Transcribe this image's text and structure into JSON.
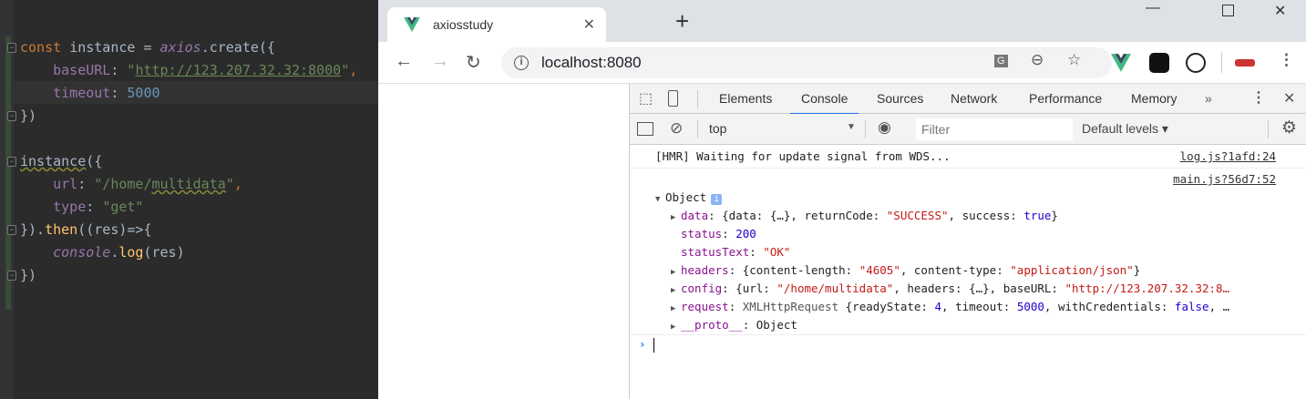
{
  "editor": {
    "lines": [
      {
        "parts": [
          [
            "kw",
            "const "
          ],
          [
            "",
            "instance = "
          ],
          [
            "it",
            "axios"
          ],
          [
            "",
            ".create({"
          ]
        ]
      },
      {
        "parts": [
          [
            "prop",
            "    baseURL"
          ],
          [
            "",
            ": "
          ],
          [
            "str",
            "\""
          ],
          [
            "url",
            "http://123.207.32.32:8000"
          ],
          [
            "str",
            "\""
          ],
          [
            "kw",
            ","
          ]
        ]
      },
      {
        "parts": [
          [
            "prop",
            "    timeout"
          ],
          [
            "",
            ": "
          ],
          [
            "num",
            "5000"
          ]
        ]
      },
      {
        "parts": [
          [
            "",
            "})"
          ]
        ]
      },
      {
        "parts": []
      },
      {
        "parts": [
          [
            "wv",
            "instance"
          ],
          [
            "",
            "({"
          ]
        ]
      },
      {
        "parts": [
          [
            "prop",
            "    url"
          ],
          [
            "",
            ": "
          ],
          [
            "str",
            "\"/home/"
          ],
          [
            "str wv",
            "multidata"
          ],
          [
            "str",
            "\""
          ],
          [
            "kw",
            ","
          ]
        ]
      },
      {
        "parts": [
          [
            "prop",
            "    type"
          ],
          [
            "",
            ": "
          ],
          [
            "str",
            "\"get\""
          ]
        ]
      },
      {
        "parts": [
          [
            "",
            "})."
          ],
          [
            "fn",
            "then"
          ],
          [
            "",
            "((res)=>{"
          ]
        ]
      },
      {
        "parts": [
          [
            "it",
            "    console"
          ],
          [
            "",
            "."
          ],
          [
            "fn",
            "log"
          ],
          [
            "",
            "(res)"
          ]
        ]
      },
      {
        "parts": [
          [
            "",
            "})"
          ]
        ]
      }
    ]
  },
  "browser": {
    "tab_title": "axiosstudy",
    "url": "localhost:8080",
    "accent": "#1a73e8"
  },
  "devtools": {
    "tabs": [
      "Elements",
      "Console",
      "Sources",
      "Network",
      "Performance",
      "Memory"
    ],
    "active_tab": "Console",
    "more": "»",
    "context": "top",
    "filter_placeholder": "Filter",
    "levels": "Default levels ▾",
    "messages": [
      {
        "text": "[HMR] Waiting for update signal from WDS...",
        "source": "log.js?1afd:24"
      }
    ],
    "object_source": "main.js?56d7:52",
    "object_label": "Object",
    "props": [
      {
        "expand": true,
        "html": [
          [
            "ok",
            "data"
          ],
          [
            "",
            ": {data: {…}, returnCode: "
          ],
          [
            "sv",
            "\"SUCCESS\""
          ],
          [
            "",
            ", success: "
          ],
          [
            "nv",
            "true"
          ],
          [
            "",
            "}"
          ]
        ]
      },
      {
        "expand": false,
        "html": [
          [
            "ok",
            "status"
          ],
          [
            "",
            ": "
          ],
          [
            "nv",
            "200"
          ]
        ]
      },
      {
        "expand": false,
        "html": [
          [
            "ok",
            "statusText"
          ],
          [
            "",
            ": "
          ],
          [
            "sv",
            "\"OK\""
          ]
        ]
      },
      {
        "expand": true,
        "html": [
          [
            "ok",
            "headers"
          ],
          [
            "",
            ": {content-length: "
          ],
          [
            "sv",
            "\"4605\""
          ],
          [
            "",
            ", content-type: "
          ],
          [
            "sv",
            "\"application/json\""
          ],
          [
            "",
            "}"
          ]
        ]
      },
      {
        "expand": true,
        "html": [
          [
            "ok",
            "config"
          ],
          [
            "",
            ": {url: "
          ],
          [
            "sv",
            "\"/home/multidata\""
          ],
          [
            "",
            ", headers: {…}, baseURL: "
          ],
          [
            "sv",
            "\"http://123.207.32.32:8…"
          ]
        ]
      },
      {
        "expand": true,
        "html": [
          [
            "ok",
            "request"
          ],
          [
            "",
            ": "
          ],
          [
            "gr",
            "XMLHttpRequest "
          ],
          [
            "",
            "{readyState: "
          ],
          [
            "nv",
            "4"
          ],
          [
            "",
            ", timeout: "
          ],
          [
            "nv",
            "5000"
          ],
          [
            "",
            ", withCredentials: "
          ],
          [
            "nv",
            "false"
          ],
          [
            "",
            ", …"
          ]
        ]
      },
      {
        "expand": true,
        "html": [
          [
            "ok",
            "__proto__"
          ],
          [
            "",
            ": Object"
          ]
        ]
      }
    ],
    "prompt": "›"
  }
}
